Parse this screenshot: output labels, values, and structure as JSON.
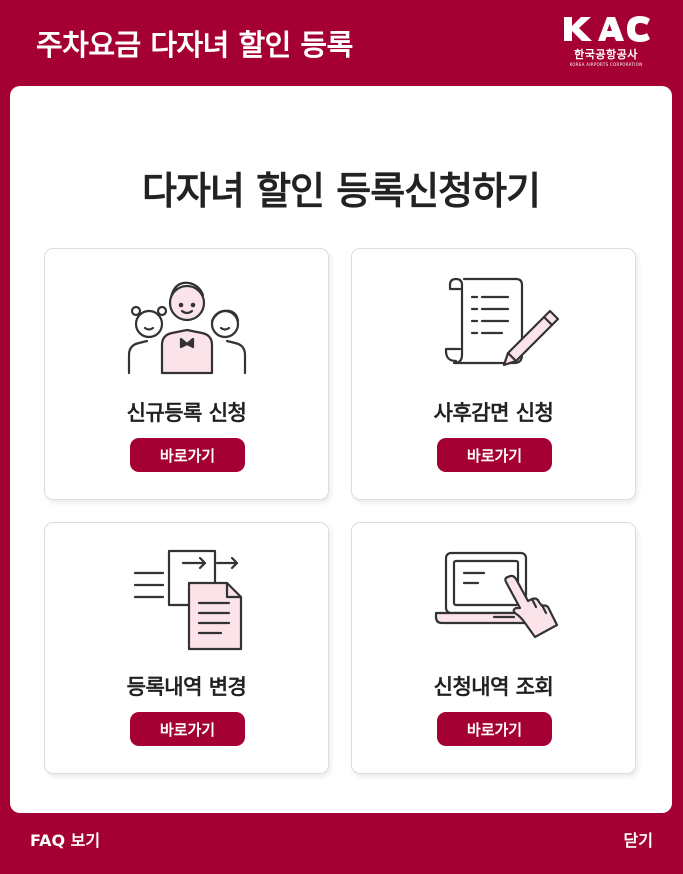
{
  "header": {
    "title": "주차요금 다자녀 할인 등록",
    "logo": {
      "mark": "KAC",
      "name": "한국공항공사",
      "sub": "KOREA AIRPORTS CORPORATION"
    }
  },
  "main": {
    "heading": "다자녀 할인 등록신청하기",
    "cards": [
      {
        "icon": "family-icon",
        "label": "신규등록 신청",
        "button": "바로가기"
      },
      {
        "icon": "document-pen-icon",
        "label": "사후감면 신청",
        "button": "바로가기"
      },
      {
        "icon": "document-transfer-icon",
        "label": "등록내역 변경",
        "button": "바로가기"
      },
      {
        "icon": "laptop-touch-icon",
        "label": "신청내역 조회",
        "button": "바로가기"
      }
    ]
  },
  "footer": {
    "faq": "FAQ 보기",
    "close": "닫기"
  },
  "colors": {
    "brand": "#a50034",
    "accent_pink": "#fbe3ea",
    "panel": "#ffffff"
  }
}
